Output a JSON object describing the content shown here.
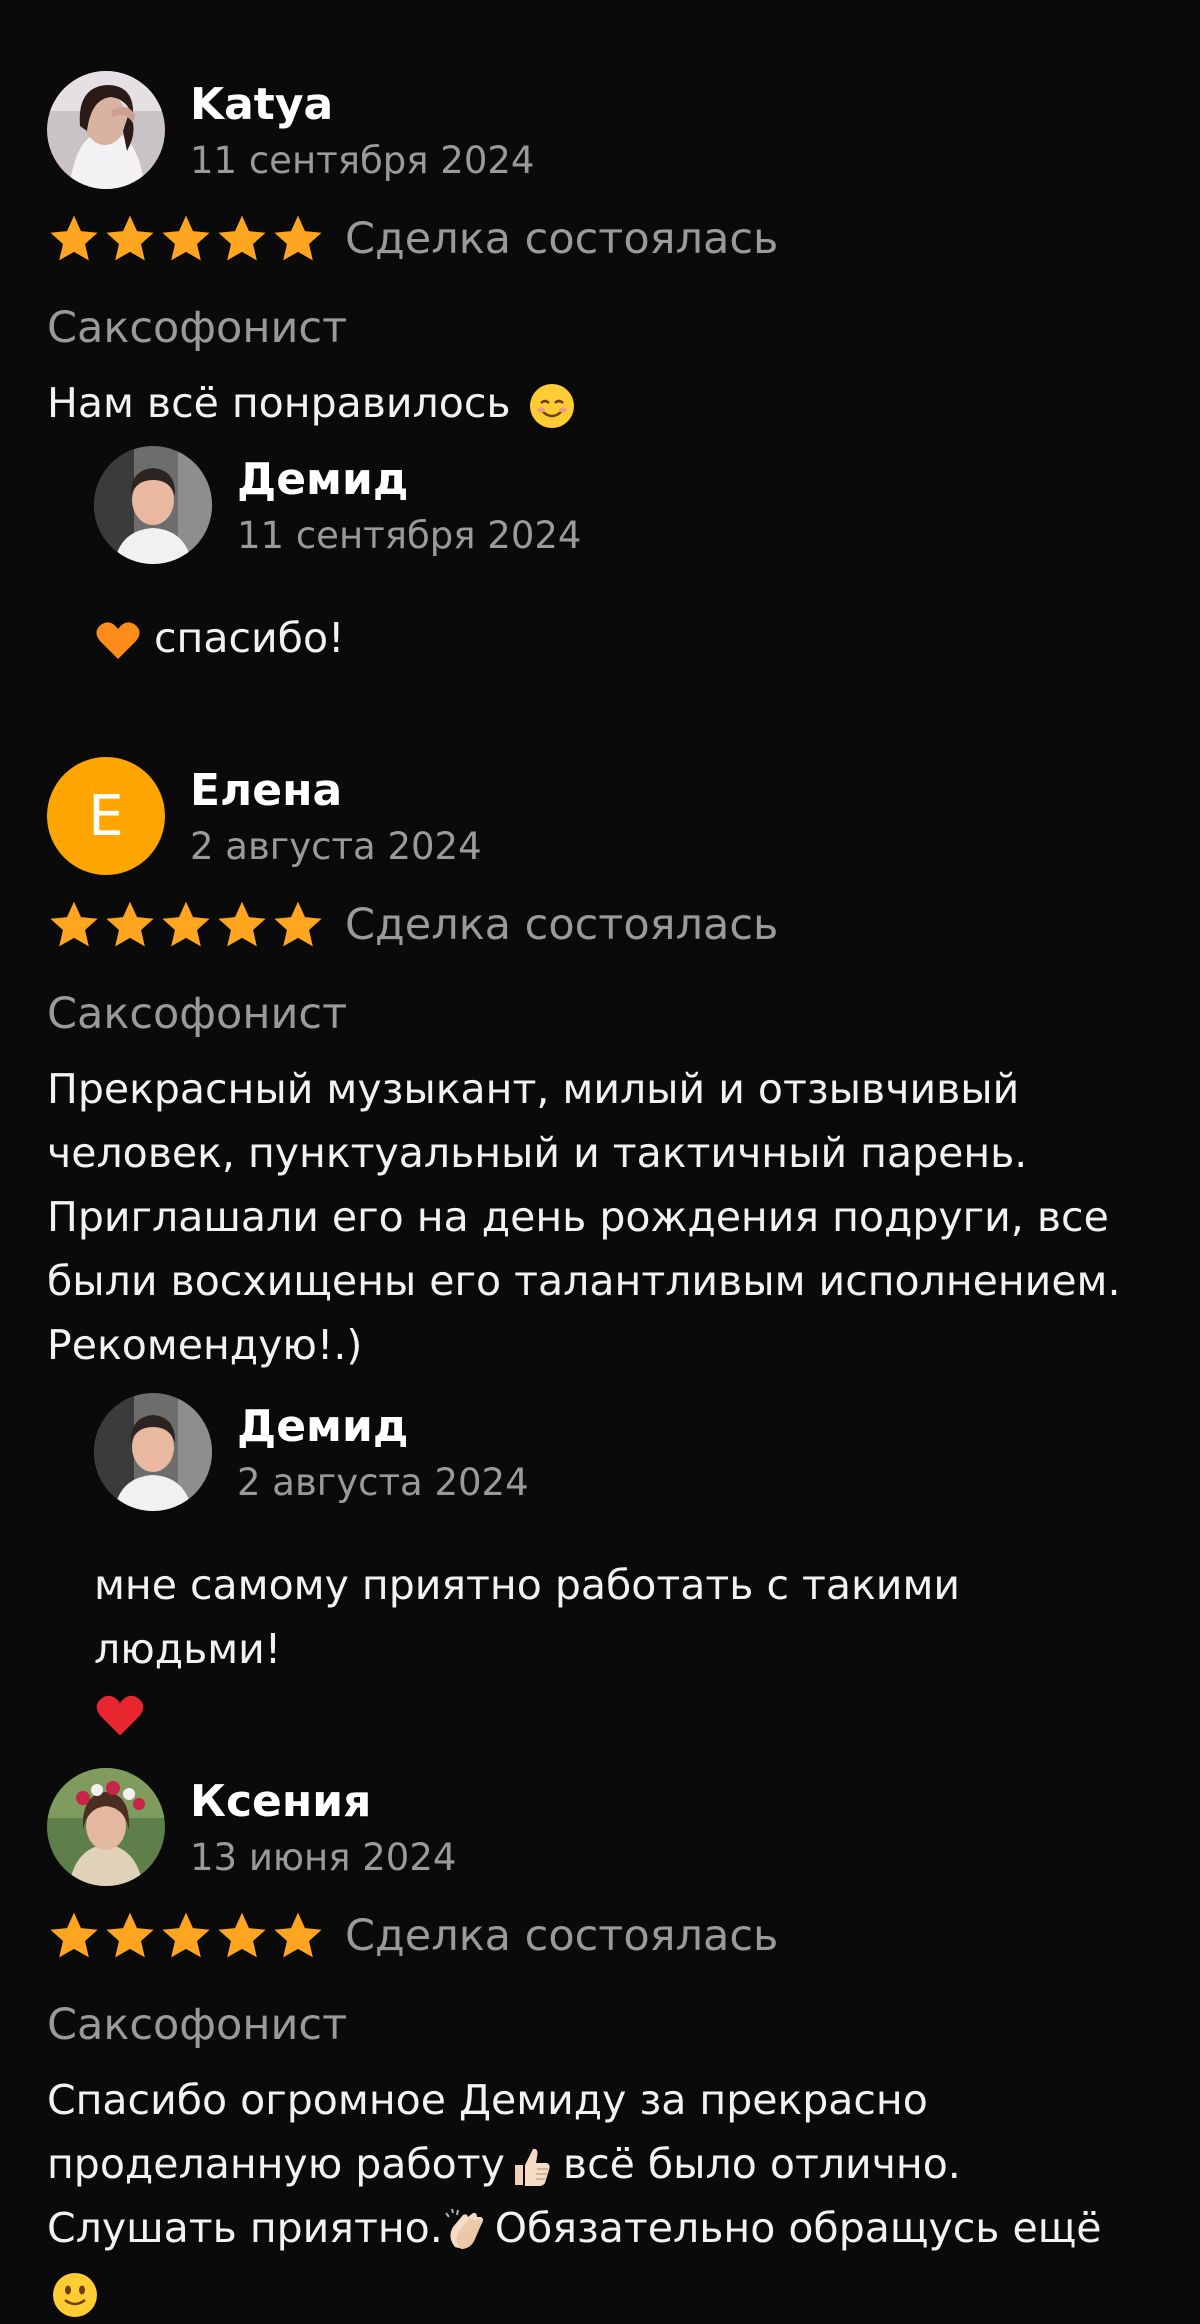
{
  "colors": {
    "background": "#0a0a0a",
    "star": "#ffa51f",
    "muted_text": "#9a9a9a",
    "avatar_letter_bg": "#ffa500",
    "text": "#f2f2f2"
  },
  "reviews": [
    {
      "author": "Katya",
      "date": "11 сентября 2024",
      "rating": 5,
      "status": "Сделка состоялась",
      "category": "Саксофонист",
      "text": "Нам всё понравилось",
      "reply": {
        "author": "Демид",
        "date": "11 сентября 2024",
        "text": "спасибо!"
      }
    },
    {
      "author": "Елена",
      "avatar_letter": "Е",
      "date": "2 августа 2024",
      "rating": 5,
      "status": "Сделка состоялась",
      "category": "Саксофонист",
      "text": "Прекрасный музыкант, милый и отзывчивый человек, пунктуальный и тактичный парень. Приглашали его на день рождения подруги, все были восхищены его талантливым исполнением. Рекомендую!.)",
      "reply": {
        "author": "Демид",
        "date": "2 августа 2024",
        "text": "мне самому приятно работать с такими людьми!"
      }
    },
    {
      "author": "Ксения",
      "date": "13 июня 2024",
      "rating": 5,
      "status": "Сделка состоялась",
      "category": "Саксофонист",
      "text_part1": "Спасибо огромное Демиду за прекрасно проделанную работу",
      "text_part2": "всё было отлично. Слушать приятно.",
      "text_part3": "Обязательно обращусь ещё"
    }
  ]
}
